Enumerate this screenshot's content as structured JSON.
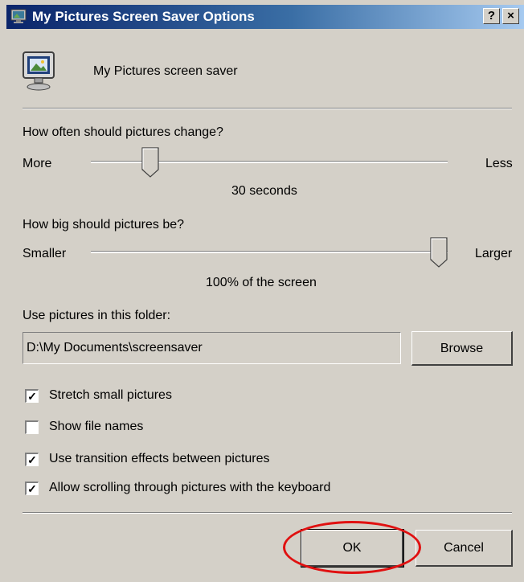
{
  "window": {
    "title": "My Pictures Screen Saver Options",
    "help_label": "?",
    "close_label": "×"
  },
  "header": {
    "description": "My Pictures screen saver"
  },
  "change_slider": {
    "question": "How often should pictures change?",
    "min_label": "More",
    "max_label": "Less",
    "value_text": "30 seconds",
    "position": 0.15
  },
  "size_slider": {
    "question": "How big should pictures be?",
    "min_label": "Smaller",
    "max_label": "Larger",
    "value_text": "100% of the screen",
    "position": 1.0
  },
  "folder": {
    "label": "Use pictures in this folder:",
    "value": "D:\\My Documents\\screensaver",
    "browse_label": "Browse"
  },
  "options": [
    {
      "label": "Stretch small pictures",
      "checked": true
    },
    {
      "label": "Show file names",
      "checked": false
    },
    {
      "label": "Use transition effects between pictures",
      "checked": true
    },
    {
      "label": "Allow scrolling through pictures with the keyboard",
      "checked": true
    }
  ],
  "footer": {
    "ok_label": "OK",
    "cancel_label": "Cancel"
  },
  "annotation": {
    "highlight_color": "#e01010"
  }
}
